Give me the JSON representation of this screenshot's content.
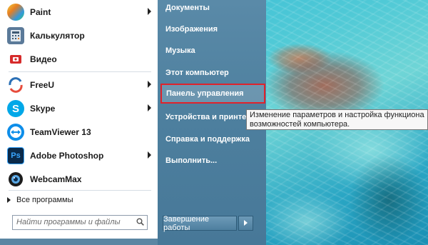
{
  "programs": [
    {
      "label": "Paint",
      "icon": "paint-icon",
      "has_submenu": true,
      "color": "#2b78c5"
    },
    {
      "label": "Калькулятор",
      "icon": "calculator-icon",
      "has_submenu": false,
      "color": "#4a6f8e"
    },
    {
      "label": "Видео",
      "icon": "video-icon",
      "has_submenu": false,
      "color": "#d62b2b"
    },
    {
      "label": "FreeU",
      "icon": "freeu-icon",
      "has_submenu": true,
      "color": "#2a6fb5"
    },
    {
      "label": "Skype",
      "icon": "skype-icon",
      "has_submenu": true,
      "color": "#00a8e8"
    },
    {
      "label": "TeamViewer 13",
      "icon": "teamviewer-icon",
      "has_submenu": false,
      "color": "#0e8ee9"
    },
    {
      "label": "Adobe Photoshop",
      "icon": "photoshop-icon",
      "has_submenu": true,
      "color": "#0a2a4a"
    },
    {
      "label": "WebcamMax",
      "icon": "webcammax-icon",
      "has_submenu": false,
      "color": "#2c2c2c"
    }
  ],
  "all_programs": "Все программы",
  "search_placeholder": "Найти программы и файлы",
  "right_items": [
    {
      "label": "Документы",
      "has_submenu": false
    },
    {
      "label": "Изображения",
      "has_submenu": false
    },
    {
      "label": "Музыка",
      "has_submenu": false
    },
    {
      "label": "Этот компьютер",
      "has_submenu": false
    },
    {
      "label": "Панель управления",
      "has_submenu": false,
      "highlighted": true
    },
    {
      "label": "Устройства и принтеры",
      "has_submenu": false
    },
    {
      "label": "Справка и поддержка",
      "has_submenu": false
    },
    {
      "label": "Выполнить...",
      "has_submenu": false
    }
  ],
  "shutdown_label": "Завершение работы",
  "tooltip": {
    "line1": "Изменение параметров и настройка функциональ",
    "line2": "возможностей компьютера."
  },
  "colors": {
    "highlight_border": "#e0222b",
    "right_pane": "#4d7f9e"
  }
}
